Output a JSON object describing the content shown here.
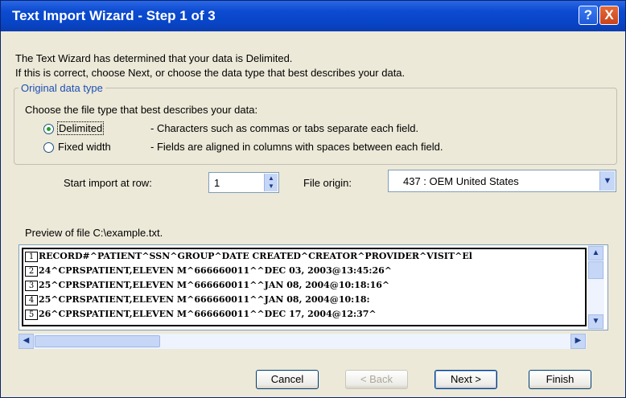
{
  "window": {
    "title": "Text Import Wizard - Step 1 of 3",
    "help_glyph": "?",
    "close_glyph": "X"
  },
  "intro": {
    "line1": "The Text Wizard has determined that your data is Delimited.",
    "line2": "If this is correct, choose Next, or choose the data type that best describes your data."
  },
  "data_type": {
    "legend": "Original data type",
    "prompt": "Choose the file type that best describes your data:",
    "options": [
      {
        "label": "Delimited",
        "selected": true,
        "description": "- Characters such as commas or tabs separate each field."
      },
      {
        "label": "Fixed width",
        "selected": false,
        "description": "- Fields are aligned in columns with spaces between each field."
      }
    ]
  },
  "start_row": {
    "label": "Start import at row:",
    "value": "1"
  },
  "file_origin": {
    "label": "File origin:",
    "value": "437 : OEM United States"
  },
  "preview": {
    "label": "Preview of file C:\\example.txt.",
    "rows": [
      {
        "num": "1",
        "text": "RECORD#^PATIENT^SSN^GROUP^DATE CREATED^CREATOR^PROVIDER^VISIT^El"
      },
      {
        "num": "2",
        "text": "24^CPRSPATIENT,ELEVEN M^666660011^^DEC 03, 2003@13:45:26^"
      },
      {
        "num": "3",
        "text": "25^CPRSPATIENT,ELEVEN M^666660011^^JAN 08, 2004@10:18:16^"
      },
      {
        "num": "4",
        "text": "25^CPRSPATIENT,ELEVEN M^666660011^^JAN 08, 2004@10:18:"
      },
      {
        "num": "5",
        "text": "26^CPRSPATIENT,ELEVEN M^666660011^^DEC 17, 2004@12:37^"
      }
    ]
  },
  "buttons": {
    "cancel": "Cancel",
    "back": "< Back",
    "next": "Next >",
    "finish": "Finish"
  },
  "colors": {
    "title_bar": "#0846c8",
    "dialog_bg": "#ece9d8",
    "group_legend": "#1d4fb5"
  }
}
